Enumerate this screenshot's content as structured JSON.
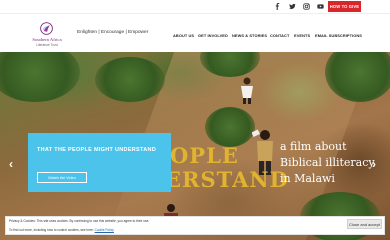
{
  "topbar": {
    "social": [
      {
        "icon": "facebook-icon"
      },
      {
        "icon": "twitter-icon"
      },
      {
        "icon": "instagram-icon"
      },
      {
        "icon": "youtube-icon"
      }
    ],
    "give_label": "HOW TO GIVE"
  },
  "header": {
    "logo_title": "Southern Africa",
    "logo_subtitle": "Literature Trust",
    "tagline": "Enlighten | Encourage | Empower",
    "nav": [
      "ABOUT US",
      "GET INVOLVED",
      "NEWS & STORIES",
      "CONTACT",
      "EVENTS",
      "EMAIL SUBSCRIPTIONS"
    ]
  },
  "hero": {
    "big_text_line1": "OPLE",
    "big_text_line2": "ERSTAND",
    "film_line1": "a film about",
    "film_line2": "Biblical illiteracy",
    "film_line3": "in Malawi",
    "prev_arrow": "‹",
    "next_arrow": "›",
    "callout_title": "THAT THE PEOPLE MIGHT UNDERSTAND",
    "callout_button": "Watch the Video"
  },
  "cookie": {
    "text1": "Privacy & Cookies: This site uses cookies. By continuing to use this website, you agree to their use.",
    "text2_prefix": "To find out more, including how to control cookies, see here: ",
    "policy_link": "Cookie Policy",
    "accept_label": "Close and accept"
  },
  "colors": {
    "give_red": "#d9262b",
    "callout_blue": "#4cc3ea",
    "headline_gold": "#e0b330",
    "logo_purple": "#7b2a7a"
  }
}
